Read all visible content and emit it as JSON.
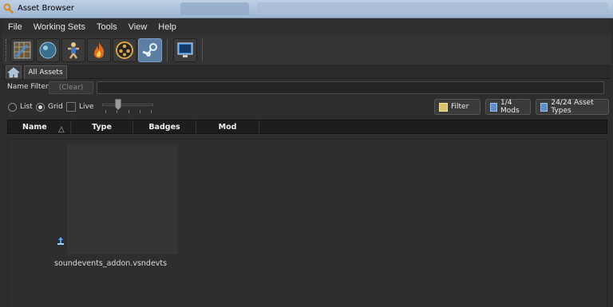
{
  "window": {
    "title": "Asset Browser"
  },
  "menu": [
    "File",
    "Working Sets",
    "Tools",
    "View",
    "Help"
  ],
  "toolbar": {
    "tools": [
      {
        "icon": "hammer-map-icon"
      },
      {
        "icon": "material-sphere-icon"
      },
      {
        "icon": "character-model-icon"
      },
      {
        "icon": "particle-fire-icon"
      },
      {
        "icon": "film-reel-icon"
      },
      {
        "icon": "steam-icon",
        "active": true
      },
      {
        "icon": "monitor-icon"
      }
    ]
  },
  "tabs": {
    "home_icon": "home-icon",
    "active": "All Assets"
  },
  "filter": {
    "label": "Name Filter:",
    "clear": "(Clear)",
    "value": ""
  },
  "view": {
    "list": "List",
    "grid": "Grid",
    "live": "Live",
    "mode": "Grid",
    "filter_button": "Filter",
    "mods_button": "1/4 Mods",
    "types_button": "24/24 Asset Types"
  },
  "columns": [
    "Name",
    "Type",
    "Badges",
    "Mod"
  ],
  "sort_icon": "△",
  "assets": [
    {
      "name": "soundevents_addon.vsndevts",
      "badge_icon": "sound-event-icon"
    }
  ]
}
